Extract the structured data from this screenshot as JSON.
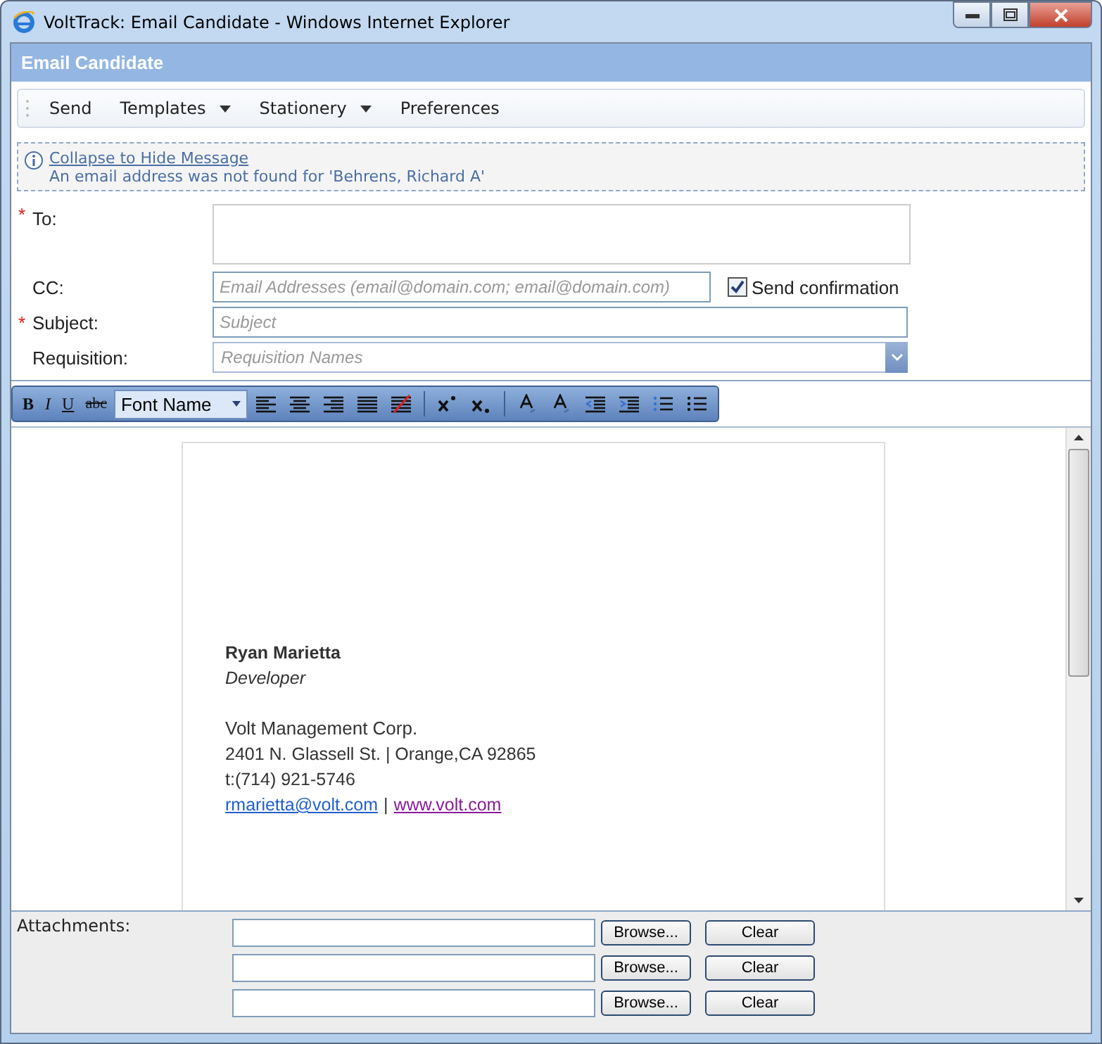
{
  "window": {
    "title": "VoltTrack: Email Candidate - Windows Internet Explorer"
  },
  "header": {
    "title": "Email Candidate"
  },
  "toolbar": [
    {
      "label": "Send",
      "dropdown": false
    },
    {
      "label": "Templates",
      "dropdown": true
    },
    {
      "label": "Stationery",
      "dropdown": true
    },
    {
      "label": "Preferences",
      "dropdown": false
    }
  ],
  "message": {
    "link": "Collapse to Hide Message",
    "text": "An email address was not found for 'Behrens, Richard A'"
  },
  "fields": [
    {
      "kind": "textarea",
      "label": "To:",
      "required_mark": "*"
    },
    {
      "kind": "input",
      "label": "CC:",
      "placeholder": "Email Addresses (email@domain.com; email@domain.com)",
      "checkbox": {
        "label": "Send confirmation",
        "checked": true
      }
    },
    {
      "kind": "input",
      "label": "Subject:",
      "required_mark": "*",
      "placeholder": "Subject"
    },
    {
      "kind": "select",
      "label": "Requisition:",
      "placeholder": "Requisition Names"
    }
  ],
  "editor_toolbar": {
    "format_buttons": [
      "B",
      "I",
      "U",
      "abc"
    ],
    "font_select": "Font Name"
  },
  "signature": {
    "name": "Ryan Marietta",
    "title": "Developer",
    "company": "Volt Management Corp.",
    "address": "2401 N. Glassell St. | Orange,CA 92865",
    "phone": "t:(714) 921-5746",
    "email": "rmarietta@volt.com",
    "separator": "|",
    "website": "www.volt.com"
  },
  "attachments": {
    "label": "Attachments:",
    "rows": [
      {
        "browse": "Browse...",
        "clear": "Clear"
      },
      {
        "browse": "Browse...",
        "clear": "Clear"
      },
      {
        "browse": "Browse...",
        "clear": "Clear"
      }
    ]
  }
}
